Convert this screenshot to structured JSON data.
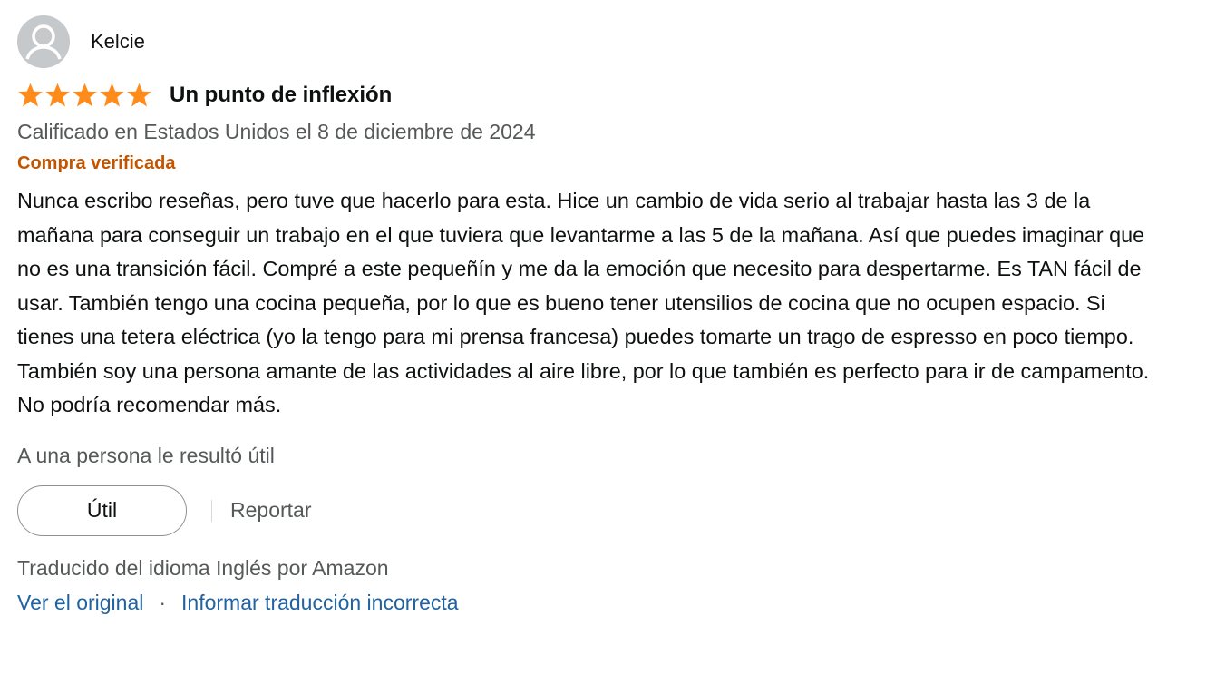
{
  "profile": {
    "name": "Kelcie",
    "avatar_icon": "user-silhouette-icon"
  },
  "review": {
    "rating": 5,
    "max_rating": 5,
    "star_color": "#ff8c1a",
    "title": "Un punto de inflexión",
    "date_line": "Calificado en Estados Unidos el 8 de diciembre de 2024",
    "verified_label": "Compra verificada",
    "body": "Nunca escribo reseñas, pero tuve que hacerlo para esta. Hice un cambio de vida serio al trabajar hasta las 3 de la mañana para conseguir un trabajo en el que tuviera que levantarme a las 5 de la mañana. Así que puedes imaginar que no es una transición fácil. Compré a este pequeñín y me da la emoción que necesito para despertarme. Es TAN fácil de usar. También tengo una cocina pequeña, por lo que es bueno tener utensilios de cocina que no ocupen espacio. Si tienes una tetera eléctrica (yo la tengo para mi prensa francesa) puedes tomarte un trago de espresso en poco tiempo. También soy una persona amante de las actividades al aire libre, por lo que también es perfecto para ir de campamento. No podría recomendar más.",
    "helpful_count_text": "A una persona le resultó útil"
  },
  "actions": {
    "helpful_label": "Útil",
    "report_label": "Reportar"
  },
  "translation": {
    "note": "Traducido del idioma Inglés por Amazon",
    "view_original": "Ver el original",
    "separator": "·",
    "report_translation": "Informar traducción incorrecta"
  },
  "colors": {
    "verified": "#c45500",
    "link": "#2162a1",
    "secondary_text": "#565959"
  }
}
